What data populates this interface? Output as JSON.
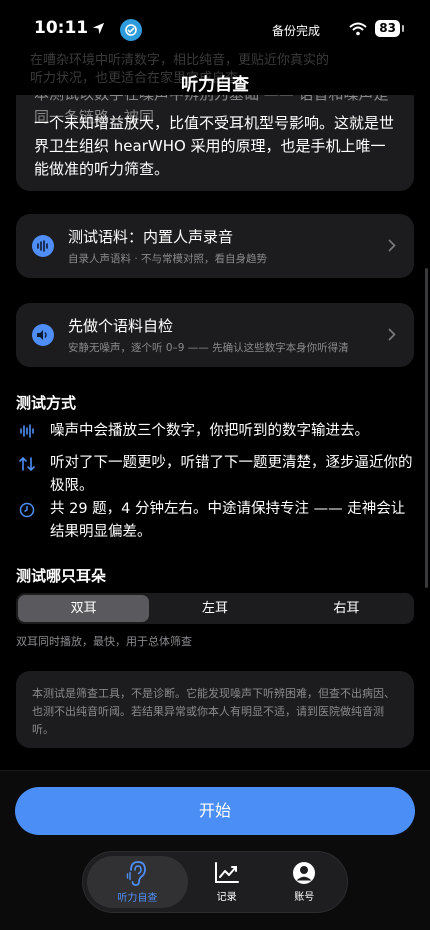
{
  "status_bar": {
    "time": "10:11",
    "island_text": "备份完成",
    "battery": "83"
  },
  "ghost_lines": [
    "在嘈杂环境中听清数字，相比纯音，更贴近你真实的",
    "听力状况，也更适合在家里完成自查。"
  ],
  "header": {
    "title": "听力自查"
  },
  "intro": {
    "clipped_line": "本测试以数字在噪声中辨别为基础 —— 语音和噪声是同一条链路，被同",
    "text": "一个未知增益放大，比值不受耳机型号影响。这就是世界卫生组织 hearWHO 采用的原理，也是手机上唯一能做准的听力筛查。"
  },
  "rows": [
    {
      "title": "测试语料：内置人声录音",
      "subtitle": "自录人声语料 · 不与常模对照，看自身趋势"
    },
    {
      "title": "先做个语料自检",
      "subtitle": "安静无噪声，逐个听 0–9 —— 先确认这些数字本身你听得清"
    }
  ],
  "method": {
    "title": "测试方式",
    "items": [
      {
        "icon": "waveform-icon",
        "text": "噪声中会播放三个数字，你把听到的数字输进去。"
      },
      {
        "icon": "up-down-arrows-icon",
        "text": "听对了下一题更吵，听错了下一题更清楚，逐步逼近你的极限。"
      },
      {
        "icon": "clock-icon",
        "text": "共 29 题，4 分钟左右。中途请保持专注 —— 走神会让结果明显偏差。"
      }
    ]
  },
  "ear": {
    "title": "测试哪只耳朵",
    "options": [
      "双耳",
      "左耳",
      "右耳"
    ],
    "selected": "双耳",
    "note": "双耳同时播放，最快，用于总体筛查"
  },
  "disclaimer": "本测试是筛查工具，不是诊断。它能发现噪声下听辨困难，但查不出病因、也测不出纯音听阈。若结果异常或你本人有明显不适，请到医院做纯音测听。",
  "start_button": "开始",
  "tabs": [
    {
      "label": "听力自查",
      "icon": "ear-icon",
      "active": true
    },
    {
      "label": "记录",
      "icon": "chart-line-icon",
      "active": false
    },
    {
      "label": "账号",
      "icon": "person-icon",
      "active": false
    }
  ],
  "colors": {
    "accent": "#4b8ff6",
    "card": "#1c1c1e",
    "background": "#000000"
  }
}
